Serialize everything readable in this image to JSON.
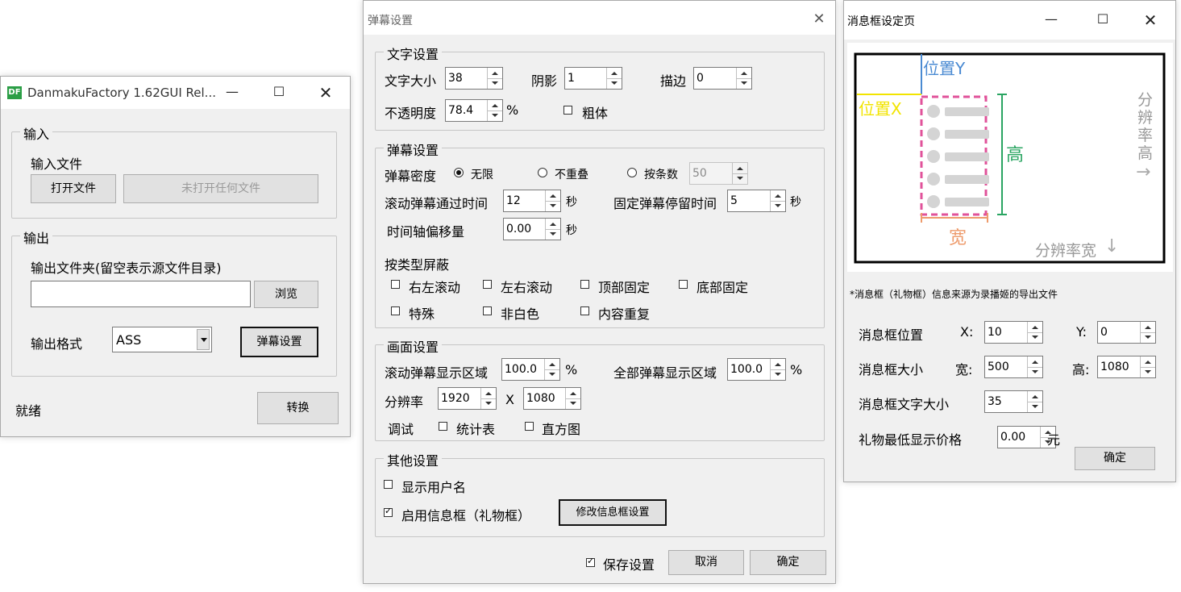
{
  "main": {
    "title": "DanmakuFactory 1.62GUI Rel...",
    "app_icon": "DF",
    "controls": [
      "minimize-icon",
      "maximize-icon",
      "close-icon"
    ],
    "input_group": "输入",
    "input_file_label": "输入文件",
    "open_button": "打开文件",
    "file_display": "未打开任何文件",
    "output_group": "输出",
    "output_folder_label": "输出文件夹(留空表示源文件目录)",
    "output_folder_value": "",
    "browse_button": "浏览",
    "format_label": "输出格式",
    "format_value": "ASS",
    "danmaku_settings_button": "弹幕设置",
    "status": "就绪",
    "convert_button": "转换"
  },
  "danmaku": {
    "title": "弹幕设置",
    "text_group": "文字设置",
    "font_size_label": "文字大小",
    "font_size": "38",
    "shadow_label": "阴影",
    "shadow": "1",
    "outline_label": "描边",
    "outline": "0",
    "opacity_label": "不透明度",
    "opacity": "78.4",
    "percent": "%",
    "bold_label": "粗体",
    "danmaku_group": "弹幕设置",
    "density_label": "弹幕密度",
    "density_unlimited": "无限",
    "density_no_overlap": "不重叠",
    "density_by_count": "按条数",
    "density_count": "50",
    "scroll_time_label": "滚动弹幕通过时间",
    "scroll_time": "12",
    "seconds": "秒",
    "fixed_time_label": "固定弹幕停留时间",
    "fixed_time": "5",
    "offset_label": "时间轴偏移量",
    "offset": "0.00",
    "block_label": "按类型屏蔽",
    "block_r2l": "右左滚动",
    "block_l2r": "左右滚动",
    "block_top": "顶部固定",
    "block_bottom": "底部固定",
    "block_special": "特殊",
    "block_nonwhite": "非白色",
    "block_repeat": "内容重复",
    "display_group": "画面设置",
    "scroll_area_label": "滚动弹幕显示区域",
    "scroll_area": "100.0",
    "all_area_label": "全部弹幕显示区域",
    "all_area": "100.0",
    "resolution_label": "分辨率",
    "res_w": "1920",
    "res_x": "X",
    "res_h": "1080",
    "debug_label": "调试",
    "debug_table": "统计表",
    "debug_histogram": "直方图",
    "other_group": "其他设置",
    "show_username": "显示用户名",
    "enable_msgbox": "启用信息框（礼物框）",
    "modify_msgbox_button": "修改信息框设置",
    "save_settings": "保存设置",
    "cancel_button": "取消",
    "ok_button": "确定"
  },
  "msgbox": {
    "title": "消息框设定页",
    "diagram": {
      "pos_y": "位置Y",
      "pos_x": "位置X",
      "height": "高",
      "width": "宽",
      "res_h": "分\n辨\n率\n高",
      "res_w": "分辨率宽",
      "colors": {
        "y": "#4a8ad2",
        "x": "#f2e400",
        "h": "#2aa562",
        "w": "#ee9b6c",
        "dash": "#e0529a",
        "gray": "#999999"
      }
    },
    "note": "*消息框（礼物框）信息来源为录播姬的导出文件",
    "position_label": "消息框位置",
    "x_label": "X:",
    "x_value": "10",
    "y_label": "Y:",
    "y_value": "0",
    "size_label": "消息框大小",
    "w_label": "宽:",
    "w_value": "500",
    "h_label": "高:",
    "h_value": "1080",
    "font_size_label": "消息框文字大小",
    "font_size": "35",
    "min_price_label": "礼物最低显示价格",
    "min_price": "0.00",
    "currency": "元",
    "ok_button": "确定"
  }
}
